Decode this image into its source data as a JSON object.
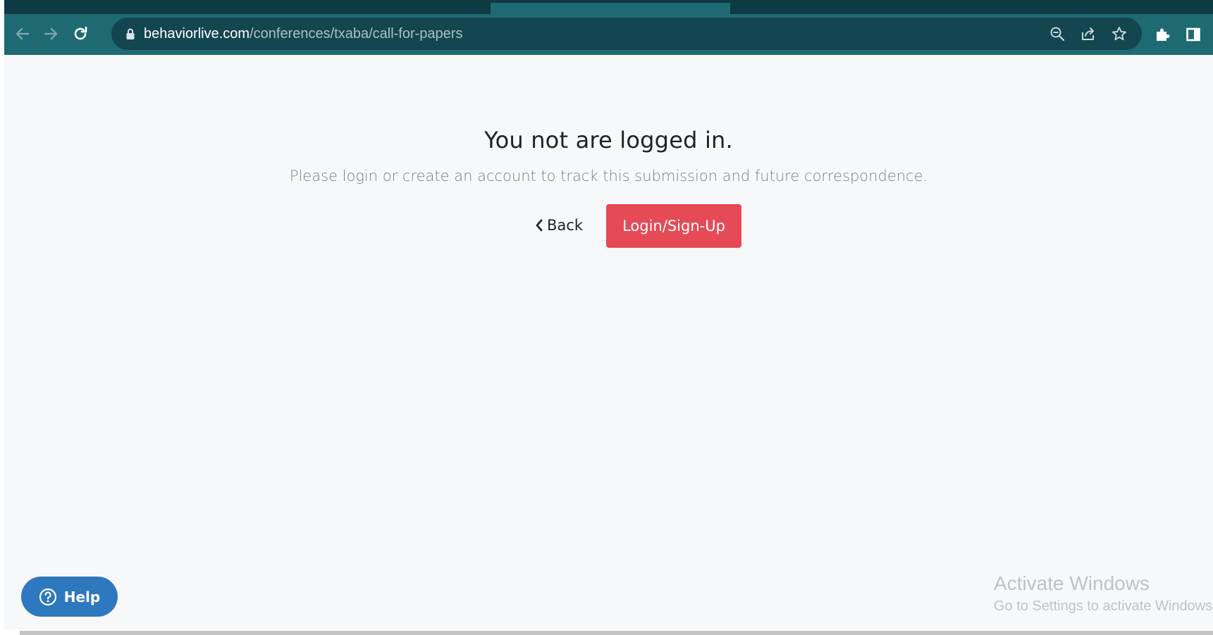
{
  "browser": {
    "url_host": "behaviorlive.com",
    "url_path": "/conferences/txaba/call-for-papers",
    "icons": {
      "back": "arrow-left-icon",
      "forward": "arrow-right-icon",
      "reload": "reload-icon",
      "lock": "lock-icon",
      "zoom": "zoom-out-icon",
      "share": "share-icon",
      "bookmark": "star-icon",
      "extensions": "puzzle-icon",
      "side_panel": "side-panel-icon"
    },
    "colors": {
      "toolbar": "#1e6a72",
      "omnibox": "#134651"
    }
  },
  "page": {
    "heading": "You not are logged in.",
    "subtext": "Please login or create an account to track this submission and future correspondence.",
    "back_label": "Back",
    "login_label": "Login/Sign-Up",
    "help_label": "Help",
    "colors": {
      "primary_button": "#e64a57",
      "help_button": "#2e78bf",
      "background": "#f7f8fa"
    }
  },
  "os_overlay": {
    "watermark_title": "Activate Windows",
    "watermark_subtitle": "Go to Settings to activate Windows."
  }
}
